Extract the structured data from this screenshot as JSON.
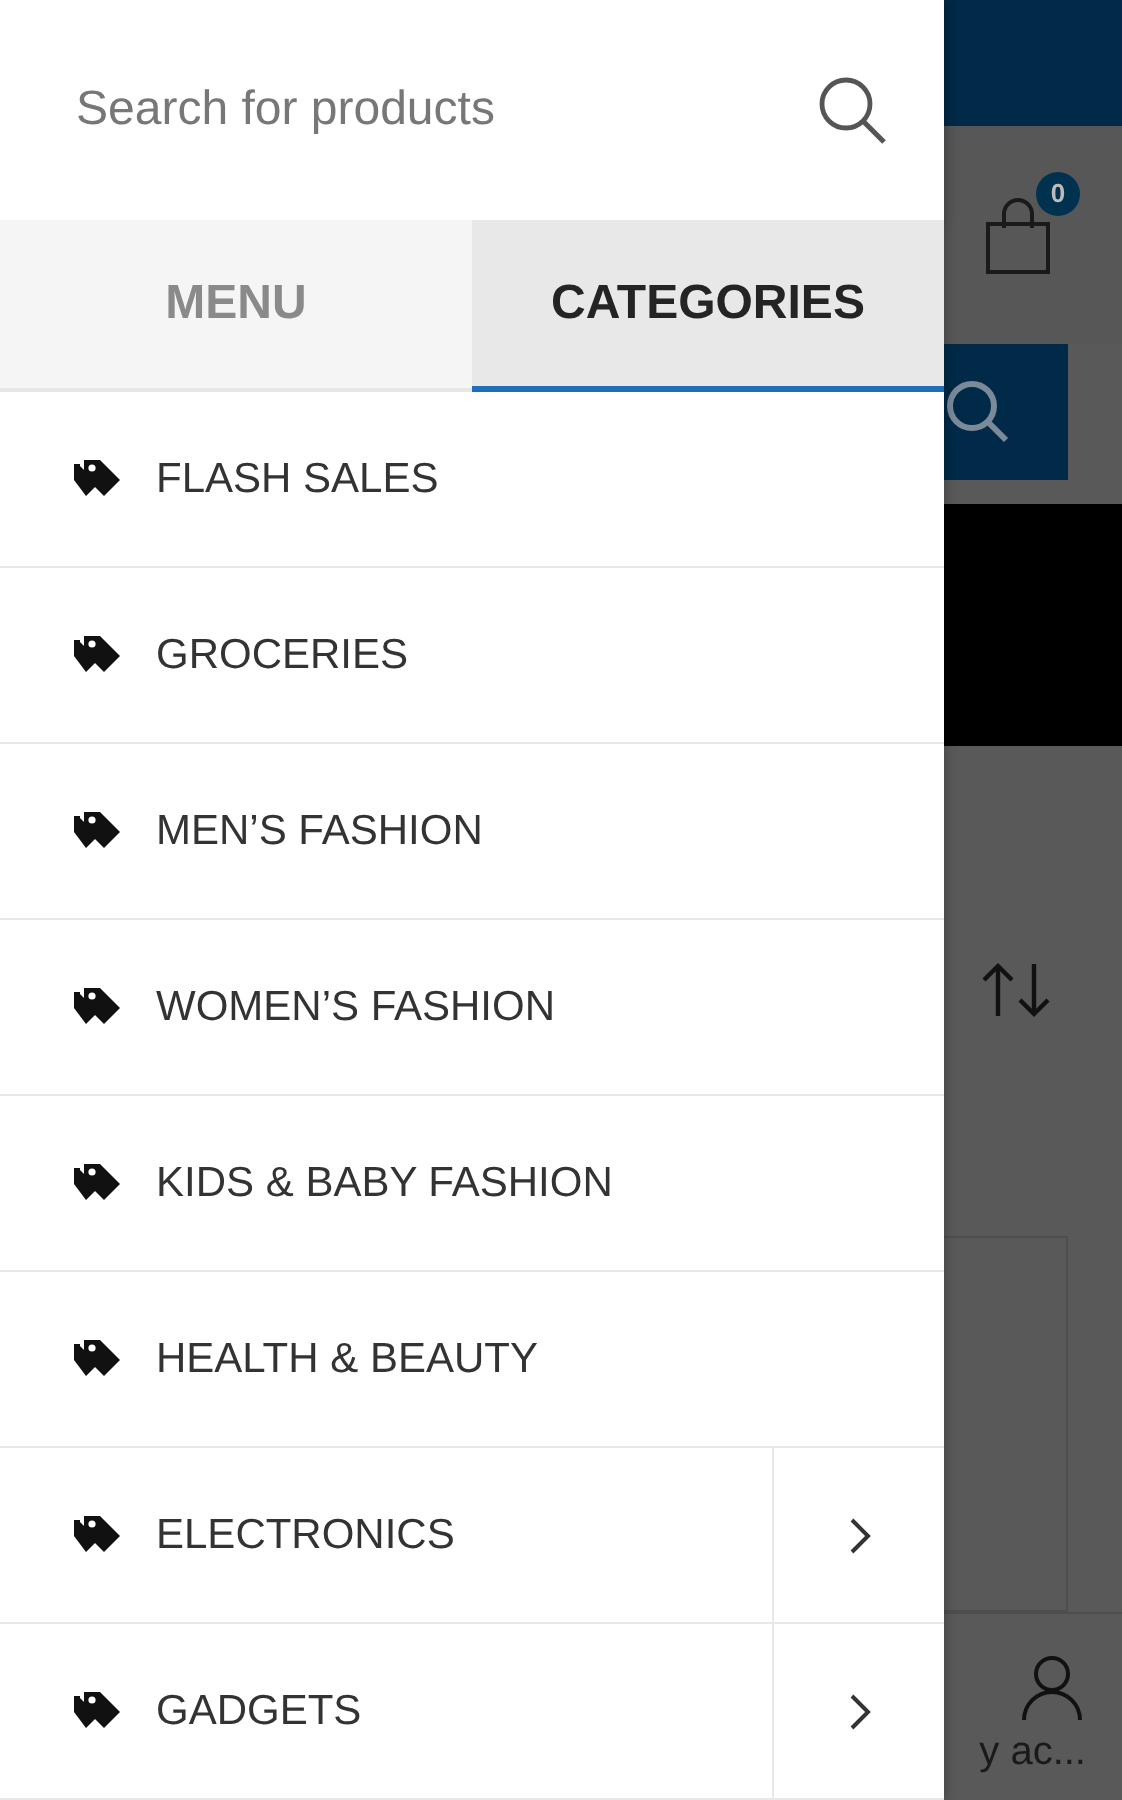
{
  "drawer": {
    "search": {
      "placeholder": "Search for products"
    },
    "tabs": [
      {
        "label": "MENU",
        "selected": false
      },
      {
        "label": "CATEGORIES",
        "selected": true
      }
    ],
    "categories": [
      {
        "label": "FLASH SALES",
        "has_submenu": false
      },
      {
        "label": "GROCERIES",
        "has_submenu": false
      },
      {
        "label": "MEN’S FASHION",
        "has_submenu": false
      },
      {
        "label": "WOMEN’S FASHION",
        "has_submenu": false
      },
      {
        "label": "KIDS & BABY FASHION",
        "has_submenu": false
      },
      {
        "label": "HEALTH & BEAUTY",
        "has_submenu": false
      },
      {
        "label": "ELECTRONICS",
        "has_submenu": true
      },
      {
        "label": "GADGETS",
        "has_submenu": true
      }
    ]
  },
  "background_page": {
    "cart_count": "0",
    "account_label": "y ac..."
  }
}
